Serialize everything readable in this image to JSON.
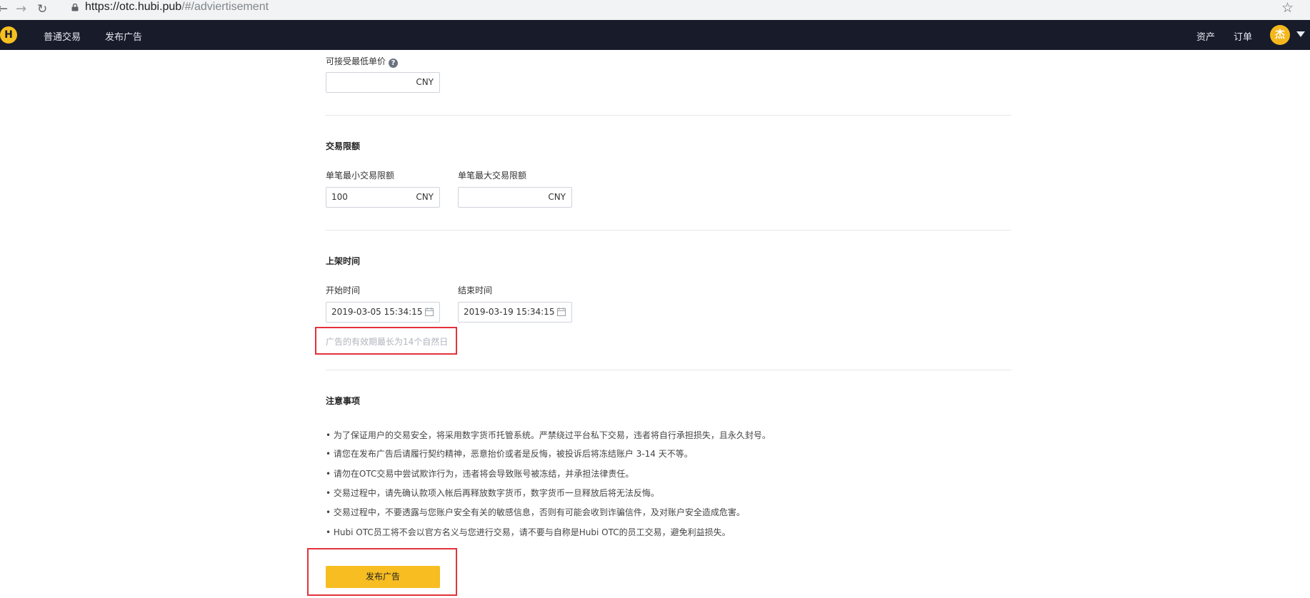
{
  "browser": {
    "back_icon": "back-arrow-icon",
    "forward_icon": "forward-arrow-icon",
    "reload_icon": "reload-icon",
    "url_host": "https://otc.hubi.pub",
    "url_path": "/#/adviertisement",
    "star_icon": "star-icon"
  },
  "nav": {
    "logo": "H",
    "items": [
      "普通交易",
      "发布广告"
    ],
    "right_items": [
      "资产",
      "订单"
    ],
    "avatar": "杰",
    "accent_color": "#f5bf21",
    "bar_color": "#181b2a"
  },
  "price": {
    "label": "可接受最低单价",
    "help": "?",
    "value": "",
    "unit": "CNY"
  },
  "limit": {
    "title": "交易限额",
    "min_label": "单笔最小交易限额",
    "min_value": "100",
    "min_unit": "CNY",
    "max_label": "单笔最大交易限额",
    "max_value": "",
    "max_unit": "CNY"
  },
  "schedule": {
    "title": "上架时间",
    "start_label": "开始时间",
    "start_value": "2019-03-05 15:34:15",
    "end_label": "结束时间",
    "end_value": "2019-03-19 15:34:15",
    "hint": "广告的有效期最长为14个自然日"
  },
  "notes": {
    "title": "注意事项",
    "items": [
      "• 为了保证用户的交易安全，将采用数字货币托管系统。严禁绕过平台私下交易，违者将自行承担损失，且永久封号。",
      "• 请您在发布广告后请履行契约精神，恶意抬价或者是反悔，被投诉后将冻结账户 3-14 天不等。",
      "• 请勿在OTC交易中尝试欺诈行为，违者将会导致账号被冻结，并承担法律责任。",
      "• 交易过程中，请先确认款项入帐后再释放数字货币，数字货币一旦释放后将无法反悔。",
      "• 交易过程中，不要透露与您账户安全有关的敏感信息，否则有可能会收到诈骗信件，及对账户安全造成危害。",
      "• Hubi OTC员工将不会以官方名义与您进行交易，请不要与自称是Hubi OTC的员工交易，避免利益损失。"
    ]
  },
  "submit": {
    "label": "发布广告",
    "color": "#f7bd21"
  },
  "annotation_color": "#e2333b"
}
